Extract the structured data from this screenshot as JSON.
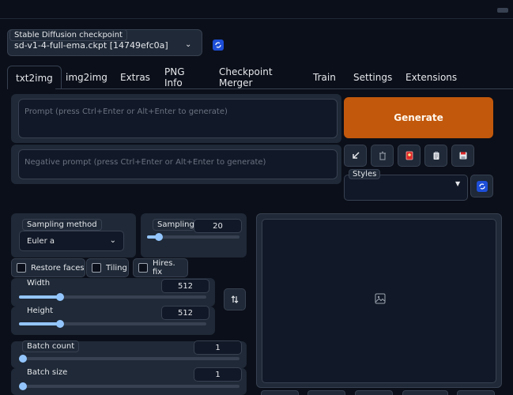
{
  "checkpoint": {
    "label": "Stable Diffusion checkpoint",
    "value": "sd-v1-4-full-ema.ckpt [14749efc0a]"
  },
  "tabs": [
    "txt2img",
    "img2img",
    "Extras",
    "PNG Info",
    "Checkpoint Merger",
    "Train",
    "Settings",
    "Extensions"
  ],
  "active_tab": "txt2img",
  "prompt": {
    "placeholder": "Prompt (press Ctrl+Enter or Alt+Enter to generate)",
    "negative_placeholder": "Negative prompt (press Ctrl+Enter or Alt+Enter to generate)"
  },
  "generate_label": "Generate",
  "tool_icons": [
    "arrow-icon",
    "trash-icon",
    "card-icon",
    "clipboard-icon",
    "save-icon"
  ],
  "styles": {
    "label": "Styles",
    "value": ""
  },
  "sampling": {
    "method_label": "Sampling method",
    "method_value": "Euler a",
    "steps_label": "Sampling s",
    "steps_value": "20",
    "steps_fill": 0.13
  },
  "checkboxes": {
    "restore_faces": "Restore faces",
    "tiling": "Tiling",
    "hires_fix": "Hires. fix"
  },
  "width": {
    "label": "Width",
    "value": "512",
    "fill": 0.22
  },
  "height": {
    "label": "Height",
    "value": "512",
    "fill": 0.22
  },
  "batch_count": {
    "label": "Batch count",
    "value": "1",
    "fill": 0.0
  },
  "batch_size": {
    "label": "Batch size",
    "value": "1",
    "fill": 0.0
  },
  "colors": {
    "accent": "#c2580c",
    "slider": "#93c5fd",
    "bg": "#0b0f19",
    "panel": "#1f2937"
  }
}
